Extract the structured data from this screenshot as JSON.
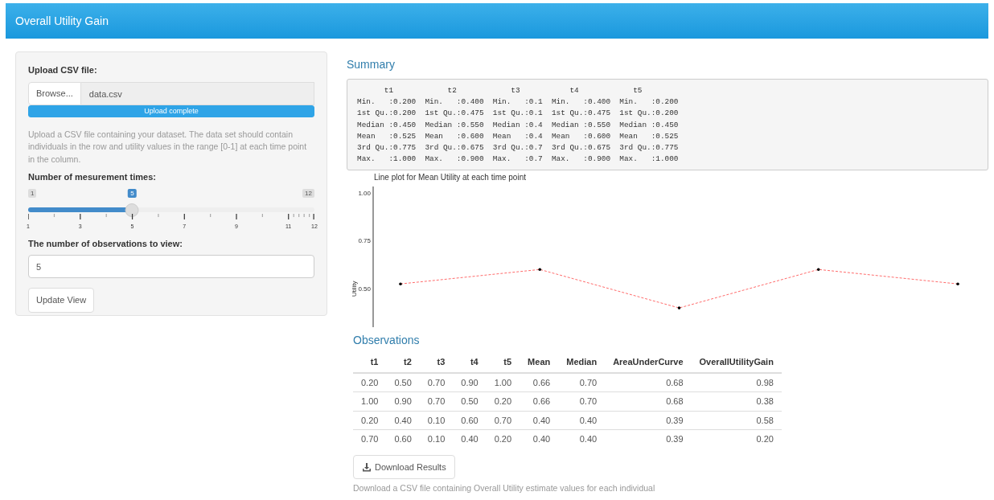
{
  "navbar": {
    "title": "Overall Utility Gain"
  },
  "sidebar": {
    "upload": {
      "label": "Upload CSV file:",
      "button": "Browse...",
      "filename": "data.csv",
      "progress_text": "Upload complete",
      "level": 1
    },
    "help_text": "Upload a CSV file containing your dataset. The data set should contain individuals in the row and utility values in the range [0-1] at each time point in the column.",
    "slider": {
      "label": "Number of mesurement times:",
      "min_label": "1",
      "max_label": "12",
      "value_label": "5",
      "level": 0.3636,
      "ticks": [
        "1",
        "3",
        "5",
        "7",
        "9",
        "11",
        "12"
      ]
    },
    "observations": {
      "label": "The number of observations to view:",
      "value": "5"
    },
    "update_button": "Update View"
  },
  "summary": {
    "heading": "Summary",
    "lines": [
      "      t1            t2            t3           t4            t5      ",
      "Min.   :0.200  Min.   :0.400  Min.   :0.1  Min.   :0.400  Min.   :0.200  ",
      "1st Qu.:0.200  1st Qu.:0.475  1st Qu.:0.1  1st Qu.:0.475  1st Qu.:0.200  ",
      "Median :0.450  Median :0.550  Median :0.4  Median :0.550  Median :0.450  ",
      "Mean   :0.525  Mean   :0.600  Mean   :0.4  Mean   :0.600  Mean   :0.525  ",
      "3rd Qu.:0.775  3rd Qu.:0.675  3rd Qu.:0.7  3rd Qu.:0.675  3rd Qu.:0.775  ",
      "Max.   :1.000  Max.   :0.900  Max.   :0.7  Max.   :0.900  Max.   :1.000  "
    ]
  },
  "chart_data": {
    "type": "line",
    "title": "Line plot for Mean Utility at each time point",
    "ylabel": "Utility",
    "ylim": [
      0.3,
      1.04
    ],
    "yticks": [
      {
        "value": 0.5,
        "label": "0.50"
      },
      {
        "value": 0.75,
        "label": "0.75"
      },
      {
        "value": 1.0,
        "label": "1.00"
      }
    ],
    "categories": [
      null,
      null,
      null,
      null,
      null
    ],
    "series": [
      {
        "color": "#ff6b6b",
        "line_style": "dashed",
        "values": [
          0.525,
          0.6,
          0.4,
          0.6,
          0.525
        ]
      }
    ]
  },
  "observations": {
    "heading": "Observations",
    "columns": [
      "t1",
      "t2",
      "t3",
      "t4",
      "t5",
      "Mean",
      "Median",
      "AreaUnderCurve",
      "OverallUtilityGain"
    ],
    "rows": [
      [
        "0.20",
        "0.50",
        "0.70",
        "0.90",
        "1.00",
        "0.66",
        "0.70",
        "0.68",
        "0.98"
      ],
      [
        "1.00",
        "0.90",
        "0.70",
        "0.50",
        "0.20",
        "0.66",
        "0.70",
        "0.68",
        "0.38"
      ],
      [
        "0.20",
        "0.40",
        "0.10",
        "0.60",
        "0.70",
        "0.40",
        "0.40",
        "0.39",
        "0.58"
      ],
      [
        "0.70",
        "0.60",
        "0.10",
        "0.40",
        "0.20",
        "0.40",
        "0.40",
        "0.39",
        "0.20"
      ]
    ]
  },
  "download": {
    "button": "Download Results",
    "help_text": "Download a CSV file containing Overall Utility estimate values for each individual"
  }
}
